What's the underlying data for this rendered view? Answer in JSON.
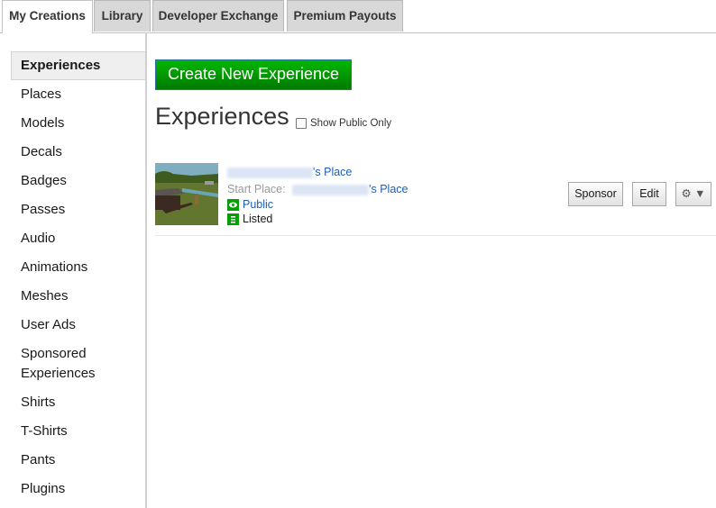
{
  "tabs": [
    {
      "label": "My Creations",
      "active": true
    },
    {
      "label": "Library",
      "active": false
    },
    {
      "label": "Developer Exchange",
      "active": false
    },
    {
      "label": "Premium Payouts",
      "active": false
    }
  ],
  "sidebar": {
    "items": [
      {
        "label": "Experiences",
        "active": true
      },
      {
        "label": "Places"
      },
      {
        "label": "Models"
      },
      {
        "label": "Decals"
      },
      {
        "label": "Badges"
      },
      {
        "label": "Passes"
      },
      {
        "label": "Audio"
      },
      {
        "label": "Animations"
      },
      {
        "label": "Meshes"
      },
      {
        "label": "User Ads"
      },
      {
        "label": "Sponsored"
      },
      {
        "label": "Shirts"
      },
      {
        "label": "T-Shirts"
      },
      {
        "label": "Pants"
      },
      {
        "label": "Plugins"
      }
    ],
    "sponsored_line2": "Experiences"
  },
  "main": {
    "create_button": "Create New Experience",
    "title": "Experiences",
    "filter_label": "Show Public Only",
    "experience": {
      "name_suffix": "'s Place",
      "start_place_label": "Start Place:",
      "start_place_suffix": "'s Place",
      "visibility": "Public",
      "listing": "Listed",
      "sponsor_button": "Sponsor",
      "edit_button": "Edit",
      "gear_menu": "⚙ ▼"
    }
  }
}
